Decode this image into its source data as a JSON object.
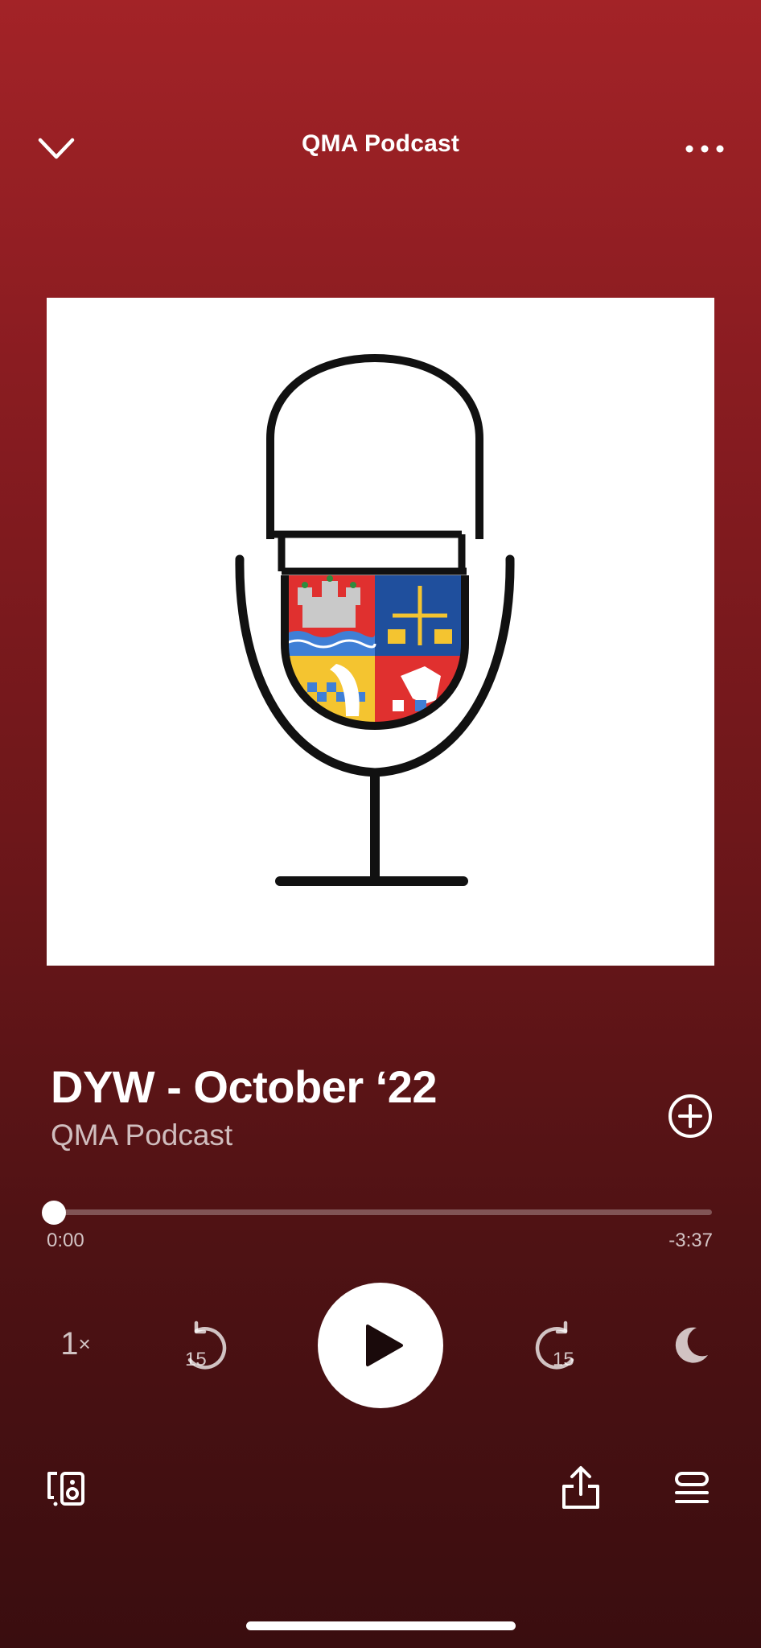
{
  "header": {
    "title": "QMA Podcast",
    "collapse_icon": "chevron-down-icon",
    "menu_icon": "more-options-icon"
  },
  "artwork": {
    "description_icon": "podcast-cover-art"
  },
  "episode": {
    "title": "DYW - October ‘22",
    "show": "QMA Podcast",
    "add_icon": "add-circle-icon"
  },
  "progress": {
    "elapsed": "0:00",
    "remaining": "-3:37",
    "fraction": 0.0
  },
  "controls": {
    "speed_value": "1",
    "speed_suffix": "×",
    "skip_back_seconds": "15",
    "skip_forward_seconds": "15",
    "play_icon": "play-icon",
    "sleep_icon": "moon-icon"
  },
  "footer": {
    "devices_icon": "connect-device-icon",
    "share_icon": "share-icon",
    "queue_icon": "queue-icon"
  },
  "colors": {
    "background_top": "#a32327",
    "background_bottom": "#3a0d0f",
    "accent": "#ffffff"
  }
}
